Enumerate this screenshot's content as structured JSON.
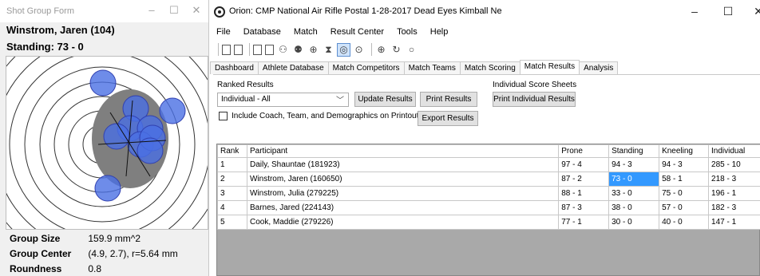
{
  "shot_group_form": {
    "title": "Shot Group Form",
    "athlete": "Winstrom, Jaren (104)",
    "standing": "Standing: 73 - 0",
    "stats": [
      {
        "label": "Group Size",
        "value": "159.9 mm^2"
      },
      {
        "label": "Group Center",
        "value": "(4.9, 2.7), r=5.64 mm"
      },
      {
        "label": "Roundness",
        "value": "0.8"
      }
    ]
  },
  "orion": {
    "title": "Orion: CMP National Air Rifle Postal 1-28-2017 Dead Eyes Kimball Ne",
    "menu": [
      "File",
      "Database",
      "Match",
      "Result Center",
      "Tools",
      "Help"
    ],
    "tabs": [
      "Dashboard",
      "Athlete Database",
      "Match Competitors",
      "Match Teams",
      "Match Scoring",
      "Match Results",
      "Analysis"
    ],
    "active_tab": "Match Results",
    "ranked_results_label": "Ranked Results",
    "select_value": "Individual - All",
    "update_button": "Update Results",
    "print_button": "Print Results",
    "individual_sheets_label": "Individual Score Sheets",
    "print_individual_button": "Print Individual Results",
    "include_checkbox_label": "Include Coach, Team, and Demographics on Printout",
    "export_button": "Export Results",
    "table": {
      "headers": [
        "Rank",
        "Participant",
        "Prone",
        "Standing",
        "Kneeling",
        "Individual"
      ],
      "rows": [
        [
          "1",
          "Daily, Shauntae (181923)",
          "97 - 4",
          "94 - 3",
          "94 - 3",
          "285 - 10"
        ],
        [
          "2",
          "Winstrom, Jaren (160650)",
          "87 - 2",
          "73 - 0",
          "58 - 1",
          "218 - 3"
        ],
        [
          "3",
          "Winstrom, Julia (279225)",
          "88 - 1",
          "33 - 0",
          "75 - 0",
          "196 - 1"
        ],
        [
          "4",
          "Barnes, Jared (224143)",
          "87 - 3",
          "38 - 0",
          "57 - 0",
          "182 - 3"
        ],
        [
          "5",
          "Cook, Maddie (279226)",
          "77 - 1",
          "30 - 0",
          "40 - 0",
          "147 - 1"
        ]
      ]
    }
  },
  "colors": {
    "selection": "#3399ff",
    "shot_fill": "#4a6fe3",
    "group_fill": "#7f7f7f"
  }
}
